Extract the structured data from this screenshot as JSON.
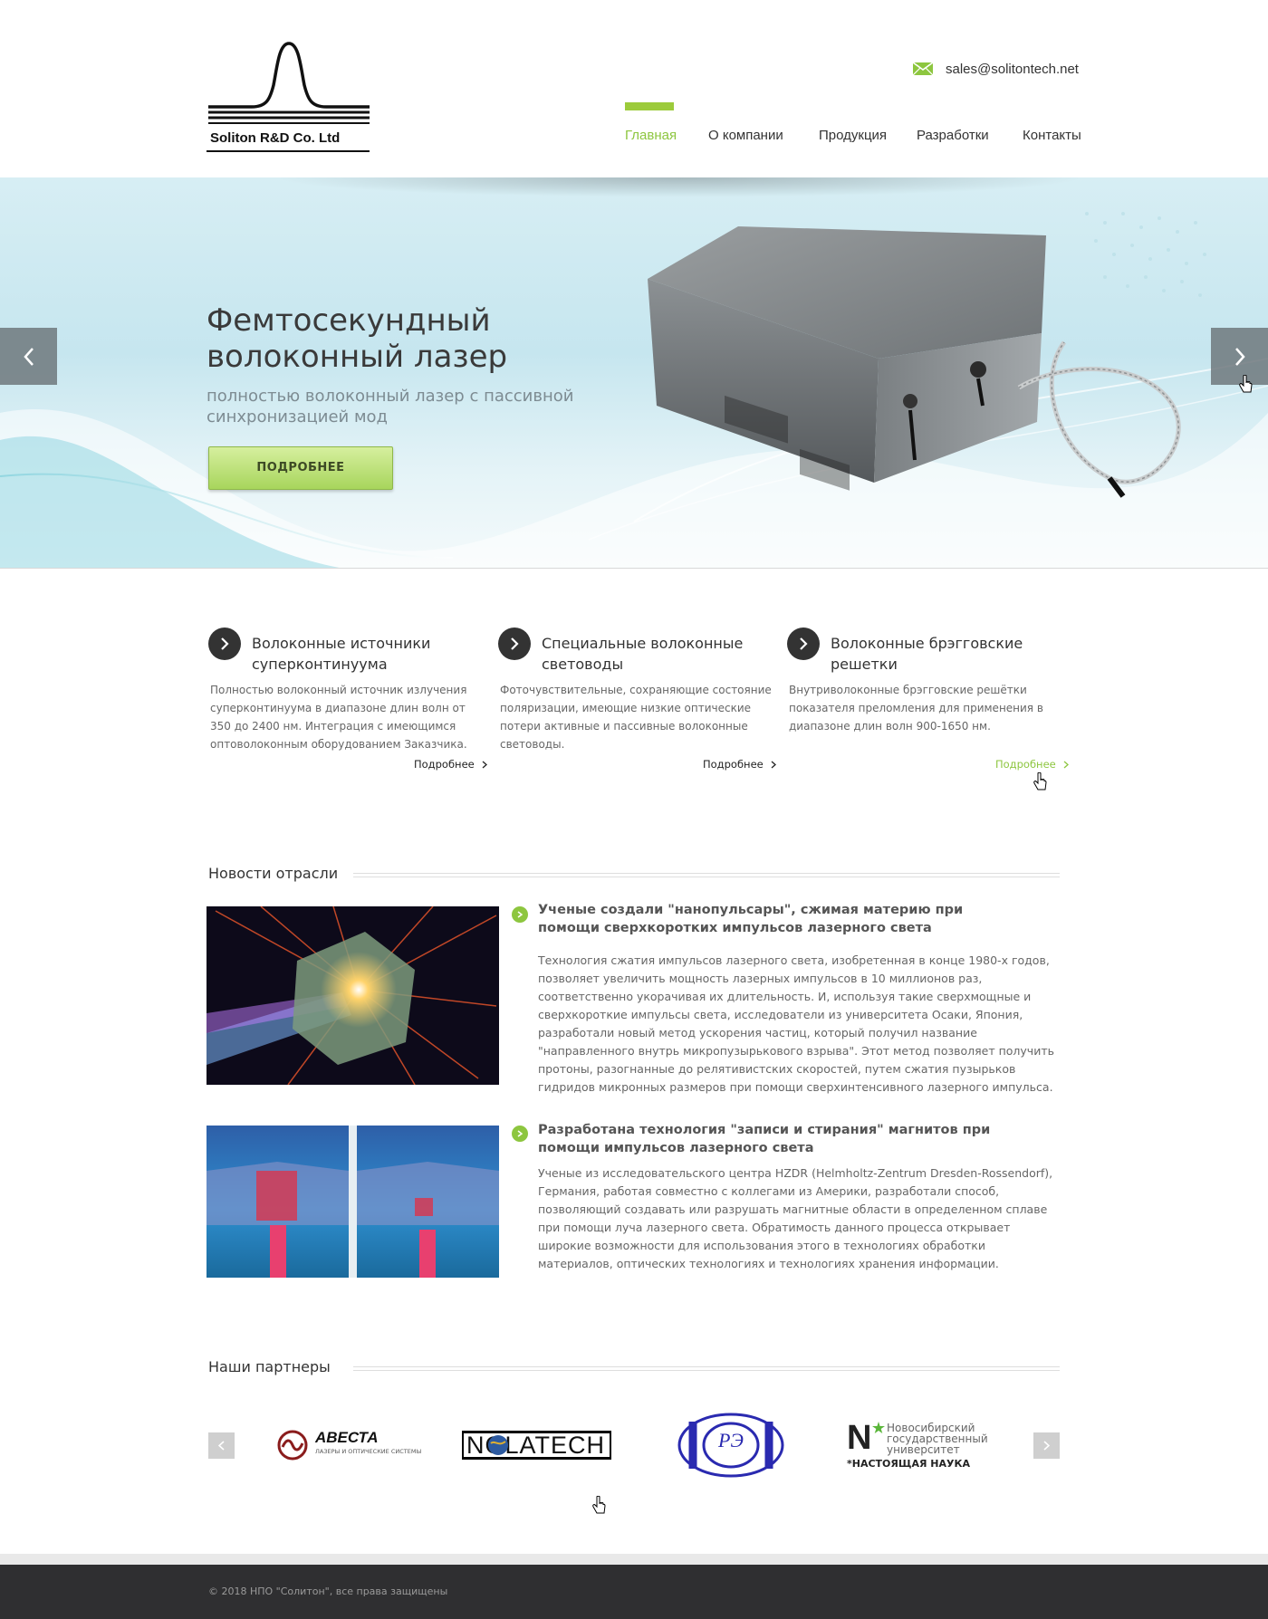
{
  "header": {
    "logo_text": "Soliton R&D Co. Ltd",
    "email": "sales@solitontech.net",
    "nav": [
      {
        "label": "Главная",
        "active": true
      },
      {
        "label": "О компании",
        "active": false
      },
      {
        "label": "Продукция",
        "active": false
      },
      {
        "label": "Разработки",
        "active": false
      },
      {
        "label": "Контакты",
        "active": false
      }
    ]
  },
  "hero": {
    "title": "Фемтосекундный волоконный лазер",
    "subtitle": "полностью волоконный лазер с пассивной синхронизацией мод",
    "button": "ПОДРОБНЕЕ"
  },
  "features": [
    {
      "title": "Волоконные источники суперконтинуума",
      "text": "Полностью волоконный источник излучения суперконтинуума в диапазоне длин волн от 350 до 2400 нм. Интеграция с имеющимся оптоволоконным оборудованием Заказчика.",
      "more": "Подробнее"
    },
    {
      "title": "Специальные волоконные световоды",
      "text": "Фоточувствительные, сохраняющие состояние поляризации, имеющие низкие оптические потери активные и пассивные волоконные световоды.",
      "more": "Подробнее"
    },
    {
      "title": "Волоконные брэгговские решетки",
      "text": "Внутриволоконные брэгговские решётки показателя преломления для применения в диапазоне длин волн 900-1650 нм.",
      "more": "Подробнее"
    }
  ],
  "news": {
    "heading": "Новости отрасли",
    "items": [
      {
        "title": "Ученые создали \"нанопульсары\", сжимая материю при помощи сверхкоротких импульсов лазерного света",
        "text": "Технология сжатия импульсов лазерного света, изобретенная в конце 1980-х годов, позволяет увеличить мощность лазерных импульсов в 10 миллионов раз, соответственно укорачивая их длительность. И, используя такие сверхмощные и сверхкороткие импульсы света, исследователи из университета Осаки, Япония, разработали новый метод ускорения частиц, который получил название \"направленного внутрь микропузырькового взрыва\". Этот метод позволяет получить протоны, разогнанные до релятивистских скоростей, путем сжатия пузырьков гидридов микронных размеров при помощи сверхинтенсивного лазерного импульса."
      },
      {
        "title": "Разработана технология \"записи и стирания\" магнитов при помощи импульсов лазерного света",
        "text": "Ученые из исследовательского центра HZDR (Helmholtz-Zentrum Dresden-Rossendorf), Германия, работая совместно с коллегами из Америки, разработали способ, позволяющий создавать или разрушать магнитные области в определенном сплаве при помощи луча лазерного света. Обратимость данного процесса открывает широкие возможности для использования этого в технологиях обработки материалов, оптических технологиях и технологиях хранения информации."
      }
    ]
  },
  "partners": {
    "heading": "Наши партнеры",
    "logos": [
      {
        "name": "АВЕСТА",
        "tagline": "ЛАЗЕРЫ И ОПТИЧЕСКИЕ СИСТЕМЫ"
      },
      {
        "name": "NOLATECH"
      },
      {
        "name": "РЭ"
      },
      {
        "name": "Новосибирский государственный университет",
        "tagline": "*НАСТОЯЩАЯ НАУКА",
        "letter": "N"
      }
    ]
  },
  "footer": {
    "copyright": "© 2018 НПО \"Солитон\", все права защищены"
  },
  "colors": {
    "accent": "#8dc63f",
    "footer_bg": "#2f2f31",
    "text": "#333333"
  }
}
